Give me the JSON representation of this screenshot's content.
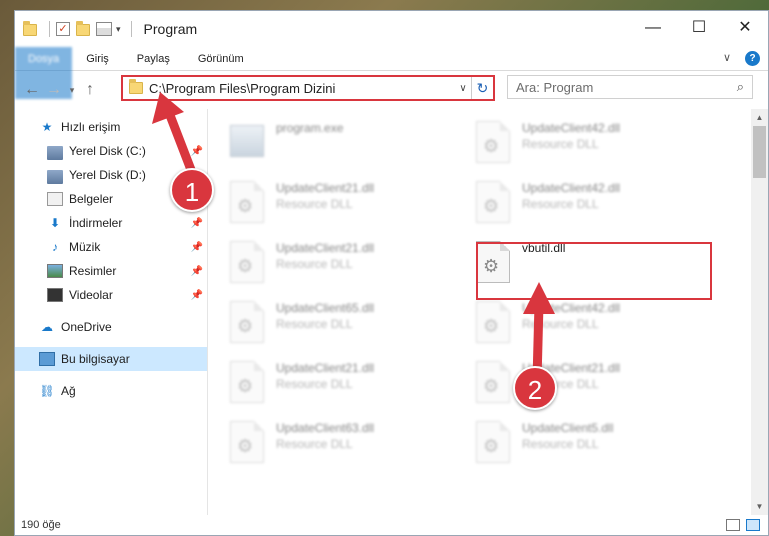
{
  "window": {
    "title": "Program",
    "controls": {
      "minimize": "—",
      "maximize": "☐",
      "close": "✕"
    }
  },
  "ribbon": {
    "tabs": [
      "Dosya",
      "Giriş",
      "Paylaş",
      "Görünüm"
    ],
    "expand_label": "∨",
    "help_label": "?"
  },
  "address": {
    "path": "C:\\Program Files\\Program Dizini",
    "refresh_icon": "refresh-icon"
  },
  "search": {
    "placeholder": "Ara: Program"
  },
  "sidebar": {
    "items": [
      {
        "label": "Hızlı erişim",
        "icon": "star-icon",
        "pinned": false
      },
      {
        "label": "Yerel Disk (C:)",
        "icon": "drive-icon",
        "pinned": true
      },
      {
        "label": "Yerel Disk (D:)",
        "icon": "drive-icon",
        "pinned": true
      },
      {
        "label": "Belgeler",
        "icon": "documents-icon",
        "pinned": true
      },
      {
        "label": "İndirmeler",
        "icon": "download-icon",
        "pinned": true
      },
      {
        "label": "Müzik",
        "icon": "music-icon",
        "pinned": true
      },
      {
        "label": "Resimler",
        "icon": "pictures-icon",
        "pinned": true
      },
      {
        "label": "Videolar",
        "icon": "videos-icon",
        "pinned": true
      },
      {
        "label": "OneDrive",
        "icon": "cloud-icon",
        "pinned": false
      },
      {
        "label": "Bu bilgisayar",
        "icon": "computer-icon",
        "pinned": false,
        "selected": true
      },
      {
        "label": "Ağ",
        "icon": "network-icon",
        "pinned": false
      }
    ]
  },
  "files": [
    {
      "name": "program.exe",
      "type": ""
    },
    {
      "name": "UpdateClient42.dll",
      "type": "Resource DLL"
    },
    {
      "name": "UpdateClient21.dll",
      "type": "Resource DLL"
    },
    {
      "name": "UpdateClient42.dll",
      "type": "Resource DLL"
    },
    {
      "name": "UpdateClient21.dll",
      "type": "Resource DLL"
    },
    {
      "name": "vbutil.dll",
      "type": ""
    },
    {
      "name": "UpdateClient65.dll",
      "type": "Resource DLL"
    },
    {
      "name": "UpdateClient42.dll",
      "type": "Resource DLL"
    },
    {
      "name": "UpdateClient21.dll",
      "type": "Resource DLL"
    },
    {
      "name": "UpdateClient21.dll",
      "type": "Resource DLL"
    },
    {
      "name": "UpdateClient63.dll",
      "type": "Resource DLL"
    },
    {
      "name": "UpdateClient5.dll",
      "type": "Resource DLL"
    }
  ],
  "status": {
    "item_count": "190 öğe"
  },
  "annotations": {
    "badge1": "1",
    "badge2": "2"
  }
}
